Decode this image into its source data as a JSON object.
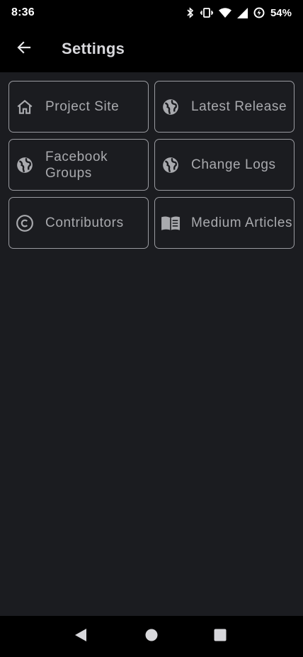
{
  "status_bar": {
    "time": "8:36",
    "battery_percent": "54%",
    "icons": [
      "bluetooth-icon",
      "vibrate-icon",
      "wifi-icon",
      "cell-signal-icon",
      "battery-saver-icon"
    ]
  },
  "app_bar": {
    "title": "Settings",
    "back_icon": "arrow-back-icon"
  },
  "cards": [
    {
      "label": "Project Site",
      "icon": "home-icon"
    },
    {
      "label": "Latest Release",
      "icon": "globe-icon"
    },
    {
      "label": "Facebook Groups",
      "icon": "globe-icon"
    },
    {
      "label": "Change Logs",
      "icon": "globe-icon"
    },
    {
      "label": "Contributors",
      "icon": "copyright-icon"
    },
    {
      "label": "Medium Articles",
      "icon": "book-icon"
    }
  ],
  "nav_bar": {
    "buttons": [
      "back-triangle-icon",
      "home-circle-icon",
      "recents-square-icon"
    ]
  },
  "colors": {
    "background": "#1b1c20",
    "bars": "#000000",
    "card_border": "#9a9ba0",
    "card_text": "#a9aaae",
    "title_text": "#d8d8dc"
  }
}
